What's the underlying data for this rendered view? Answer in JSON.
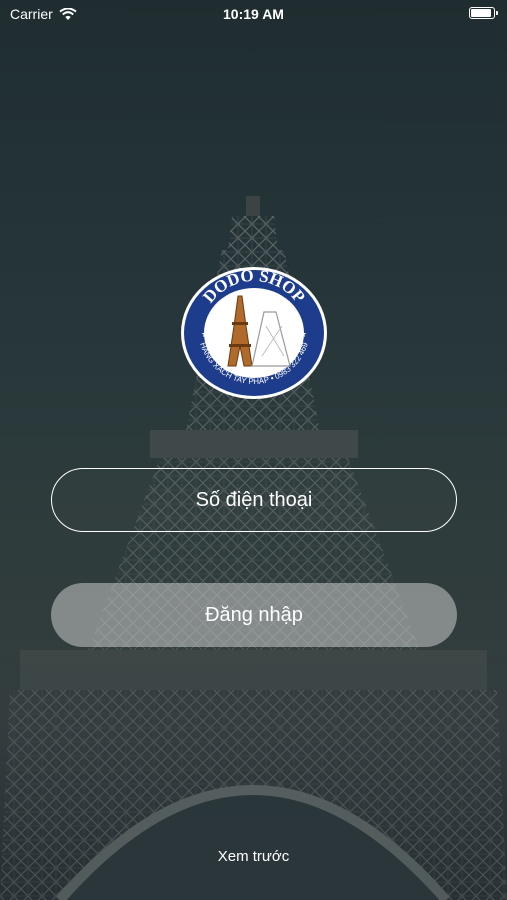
{
  "status_bar": {
    "carrier": "Carrier",
    "time": "10:19 AM",
    "wifi_icon": "wifi-icon",
    "battery_icon": "battery-icon"
  },
  "logo": {
    "brand": "DODO SHOP",
    "tagline": "HÀNG XÁCH TAY PHÁP • 0983 322 469",
    "icon": "eiffel-tower-icon"
  },
  "form": {
    "phone_placeholder": "Số điện thoại",
    "login_label": "Đăng nhập"
  },
  "preview_label": "Xem trước",
  "colors": {
    "logo_blue": "#1e3c8c",
    "field_border": "#ffffff",
    "button_fill": "#c8c8c8"
  }
}
